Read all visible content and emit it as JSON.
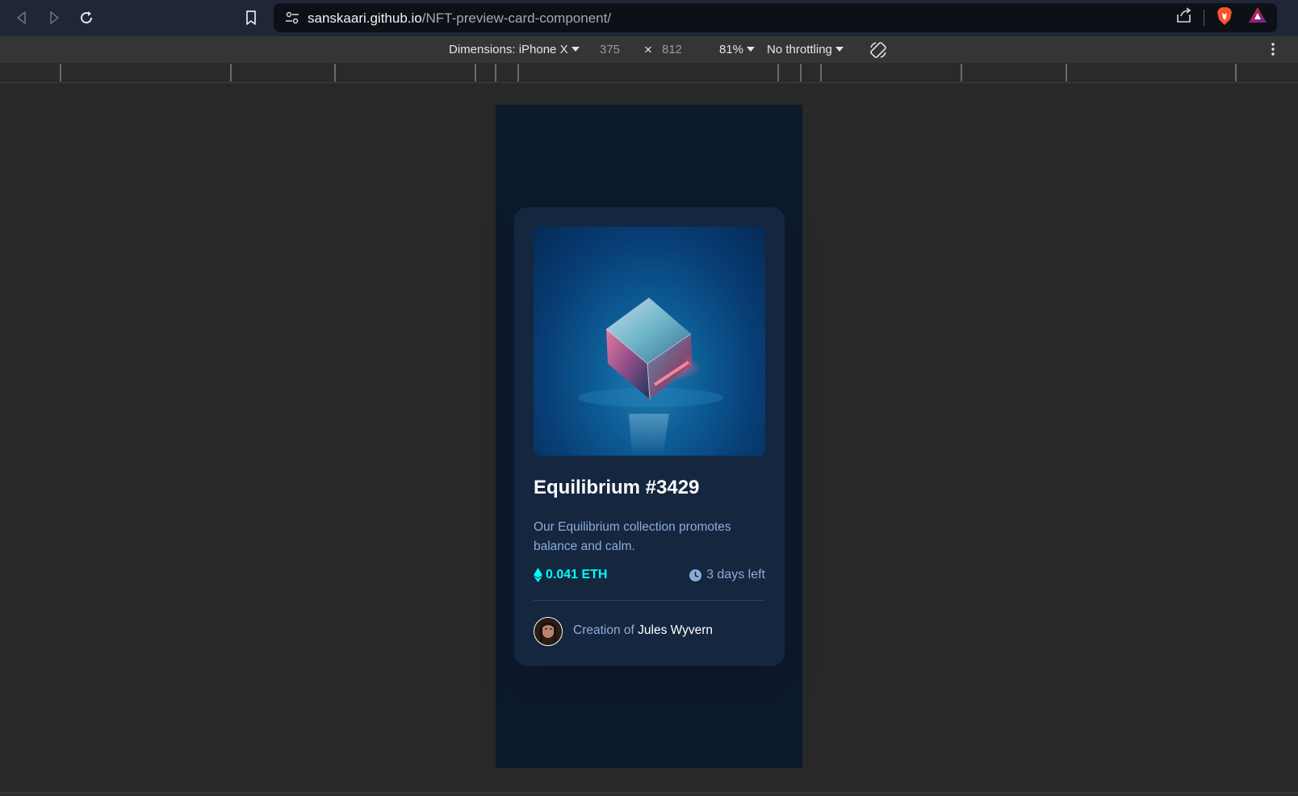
{
  "browser": {
    "url_host": "sanskaari.github.io",
    "url_path": "/NFT-preview-card-component/",
    "icons": [
      "back-icon",
      "forward-icon",
      "reload-icon",
      "bookmark-icon",
      "site-settings-icon",
      "share-icon",
      "brave-shield-icon",
      "brave-rewards-icon"
    ]
  },
  "devtools": {
    "dimensions_label": "Dimensions: iPhone X",
    "width_value": "375",
    "times_sign": "×",
    "height_value": "812",
    "zoom_label": "81%",
    "throttling_label": "No throttling",
    "icons": [
      "rotate-icon",
      "more-options-icon"
    ]
  },
  "card": {
    "title": "Equilibrium #3429",
    "description": "Our Equilibrium collection promotes balance and calm.",
    "price": "0.041 ETH",
    "time_left": "3 days left",
    "creation_prefix": "Creation of",
    "creator_name": "Jules Wyvern",
    "colors": {
      "background": "#0d192c",
      "card": "#15263f",
      "cyan": "#00fff8",
      "soft_blue": "#8bacda",
      "white": "#ffffff"
    }
  }
}
